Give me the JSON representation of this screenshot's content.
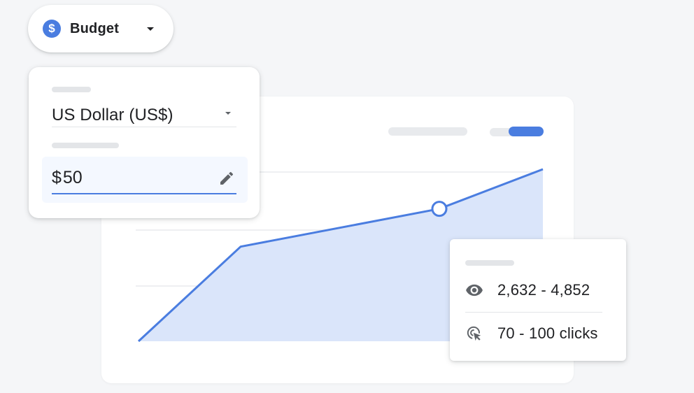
{
  "budget_chip": {
    "label": "Budget",
    "icon_glyph": "$",
    "icon": "dollar-circle-icon",
    "accent_color": "#4a7de0"
  },
  "currency_panel": {
    "currency_value": "US Dollar (US$)",
    "amount_prefix": "$",
    "amount_value": "50",
    "edit_icon": "pencil-icon"
  },
  "chart": {
    "line_color": "#4a7de0",
    "fill_color": "#dae5fa",
    "toggle_state": "on"
  },
  "chart_data": {
    "type": "area",
    "x": [
      0,
      1,
      2,
      3
    ],
    "values": [
      0,
      0.55,
      0.77,
      1
    ],
    "highlight_index": 2,
    "title": "",
    "xlabel": "",
    "ylabel": "",
    "grid": true
  },
  "tooltip": {
    "impressions": "2,632 - 4,852",
    "clicks": "70 - 100 clicks",
    "impressions_icon": "eye-icon",
    "clicks_icon": "click-cursor-icon"
  }
}
